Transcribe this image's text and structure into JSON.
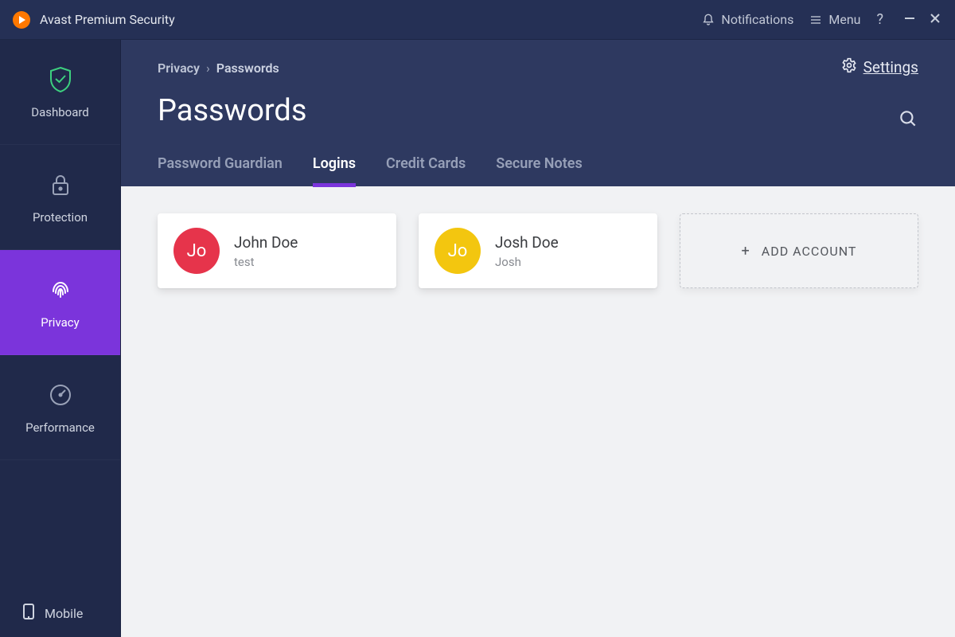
{
  "app": {
    "title": "Avast Premium Security"
  },
  "titlebar": {
    "notifications": "Notifications",
    "menu": "Menu"
  },
  "sidebar": {
    "items": [
      {
        "label": "Dashboard"
      },
      {
        "label": "Protection"
      },
      {
        "label": "Privacy"
      },
      {
        "label": "Performance"
      }
    ],
    "bottom": {
      "label": "Mobile"
    }
  },
  "breadcrumb": {
    "parent": "Privacy",
    "sep": "›",
    "current": "Passwords"
  },
  "page": {
    "title": "Passwords",
    "settings": "Settings"
  },
  "tabs": [
    {
      "label": "Password Guardian"
    },
    {
      "label": "Logins"
    },
    {
      "label": "Credit Cards"
    },
    {
      "label": "Secure Notes"
    }
  ],
  "logins": [
    {
      "initials": "Jo",
      "name": "John Doe",
      "sub": "test",
      "color": "#e6344b"
    },
    {
      "initials": "Jo",
      "name": "Josh Doe",
      "sub": "Josh",
      "color": "#f3c60f"
    }
  ],
  "add_account": {
    "label": "ADD ACCOUNT",
    "plus": "+"
  },
  "colors": {
    "accent": "#7b34db"
  }
}
